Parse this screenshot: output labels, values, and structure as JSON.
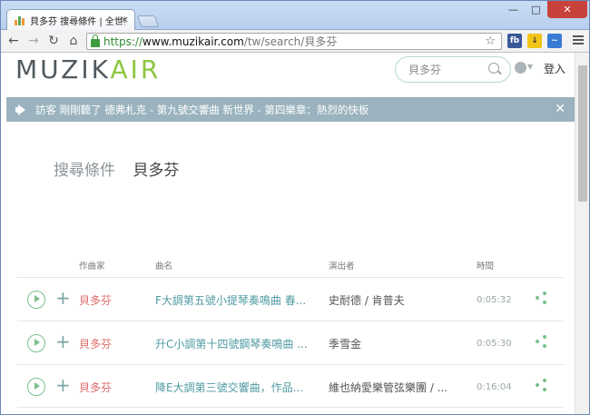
{
  "browser": {
    "tab_title": "貝多芬 搜尋條件 | 全世界",
    "tab_close": "×",
    "window_min": "—",
    "window_max": "□",
    "window_close": "✕",
    "url_scheme": "https://",
    "url_host": "www.muzikair.com",
    "url_path": "/tw/search/貝多芬",
    "ext_fb": "fb"
  },
  "header": {
    "logo_part1": "MUZIK",
    "logo_part2": "AIR",
    "search_value": "貝多芬",
    "login_label": "登入"
  },
  "notice": {
    "text": "訪客 剛剛聽了 德弗札克 - 第九號交響曲 新世界 - 第四樂章：熱烈的快板",
    "close": "✕"
  },
  "search": {
    "label": "搜尋條件",
    "query": "貝多芬"
  },
  "table": {
    "headers": {
      "composer": "作曲家",
      "title": "曲名",
      "performer": "演出者",
      "time": "時間"
    },
    "rows": [
      {
        "composer": "貝多芬",
        "title": "F大調第五號小提琴奏鳴曲 春...",
        "performer": "史耐德 / 肯普夫",
        "duration": "0:05:32"
      },
      {
        "composer": "貝多芬",
        "title": "升C小調第十四號鋼琴奏鳴曲 ...",
        "performer": "季雪金",
        "duration": "0:05:30"
      },
      {
        "composer": "貝多芬",
        "title": "降E大調第三號交響曲，作品...",
        "performer": "維也納愛樂管弦樂團 / ...",
        "duration": "0:16:04"
      }
    ]
  },
  "colors": {
    "accent_green": "#8dc63f",
    "composer_red": "#e06b6b",
    "title_teal": "#4f9aa3",
    "notice_bg": "#9ab3be"
  }
}
